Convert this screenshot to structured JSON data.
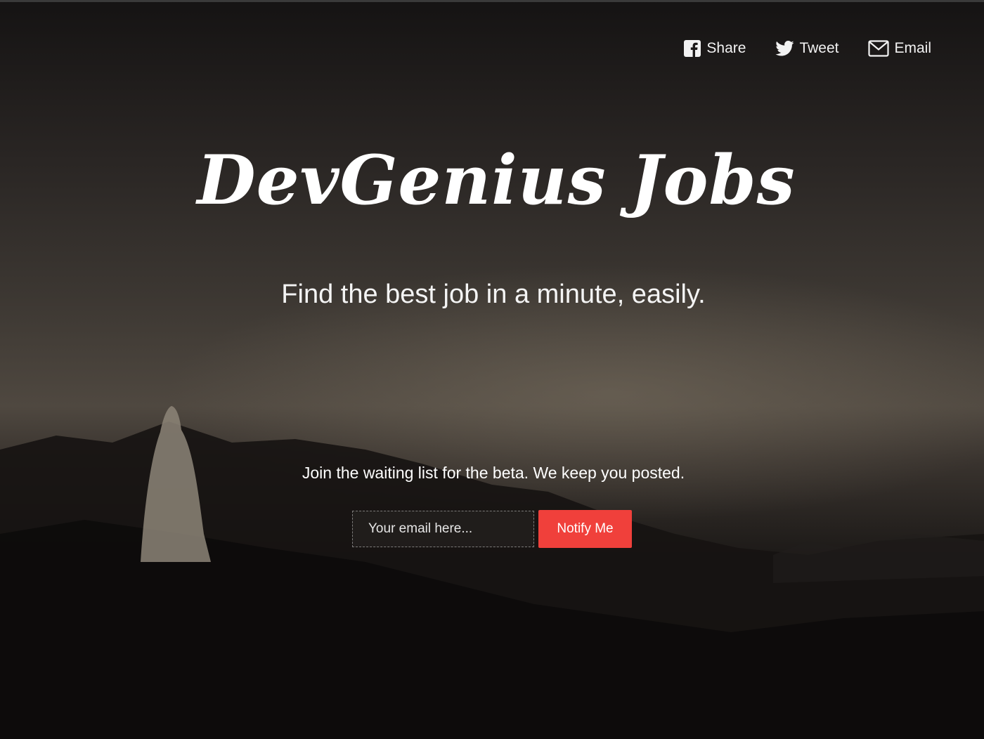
{
  "social": {
    "share_label": "Share",
    "share_icon": "facebook-icon",
    "tweet_label": "Tweet",
    "tweet_icon": "twitter-icon",
    "email_label": "Email",
    "email_icon": "envelope-icon"
  },
  "hero": {
    "brand": "DevGenius Jobs",
    "tagline": "Find the best job in a minute, easily."
  },
  "signup": {
    "prompt": "Join the waiting list for the beta. We keep you posted.",
    "email_placeholder": "Your email here...",
    "email_value": "",
    "button_label": "Notify Me"
  },
  "colors": {
    "accent": "#f0403b",
    "text": "#ffffff",
    "background": "#141212"
  }
}
